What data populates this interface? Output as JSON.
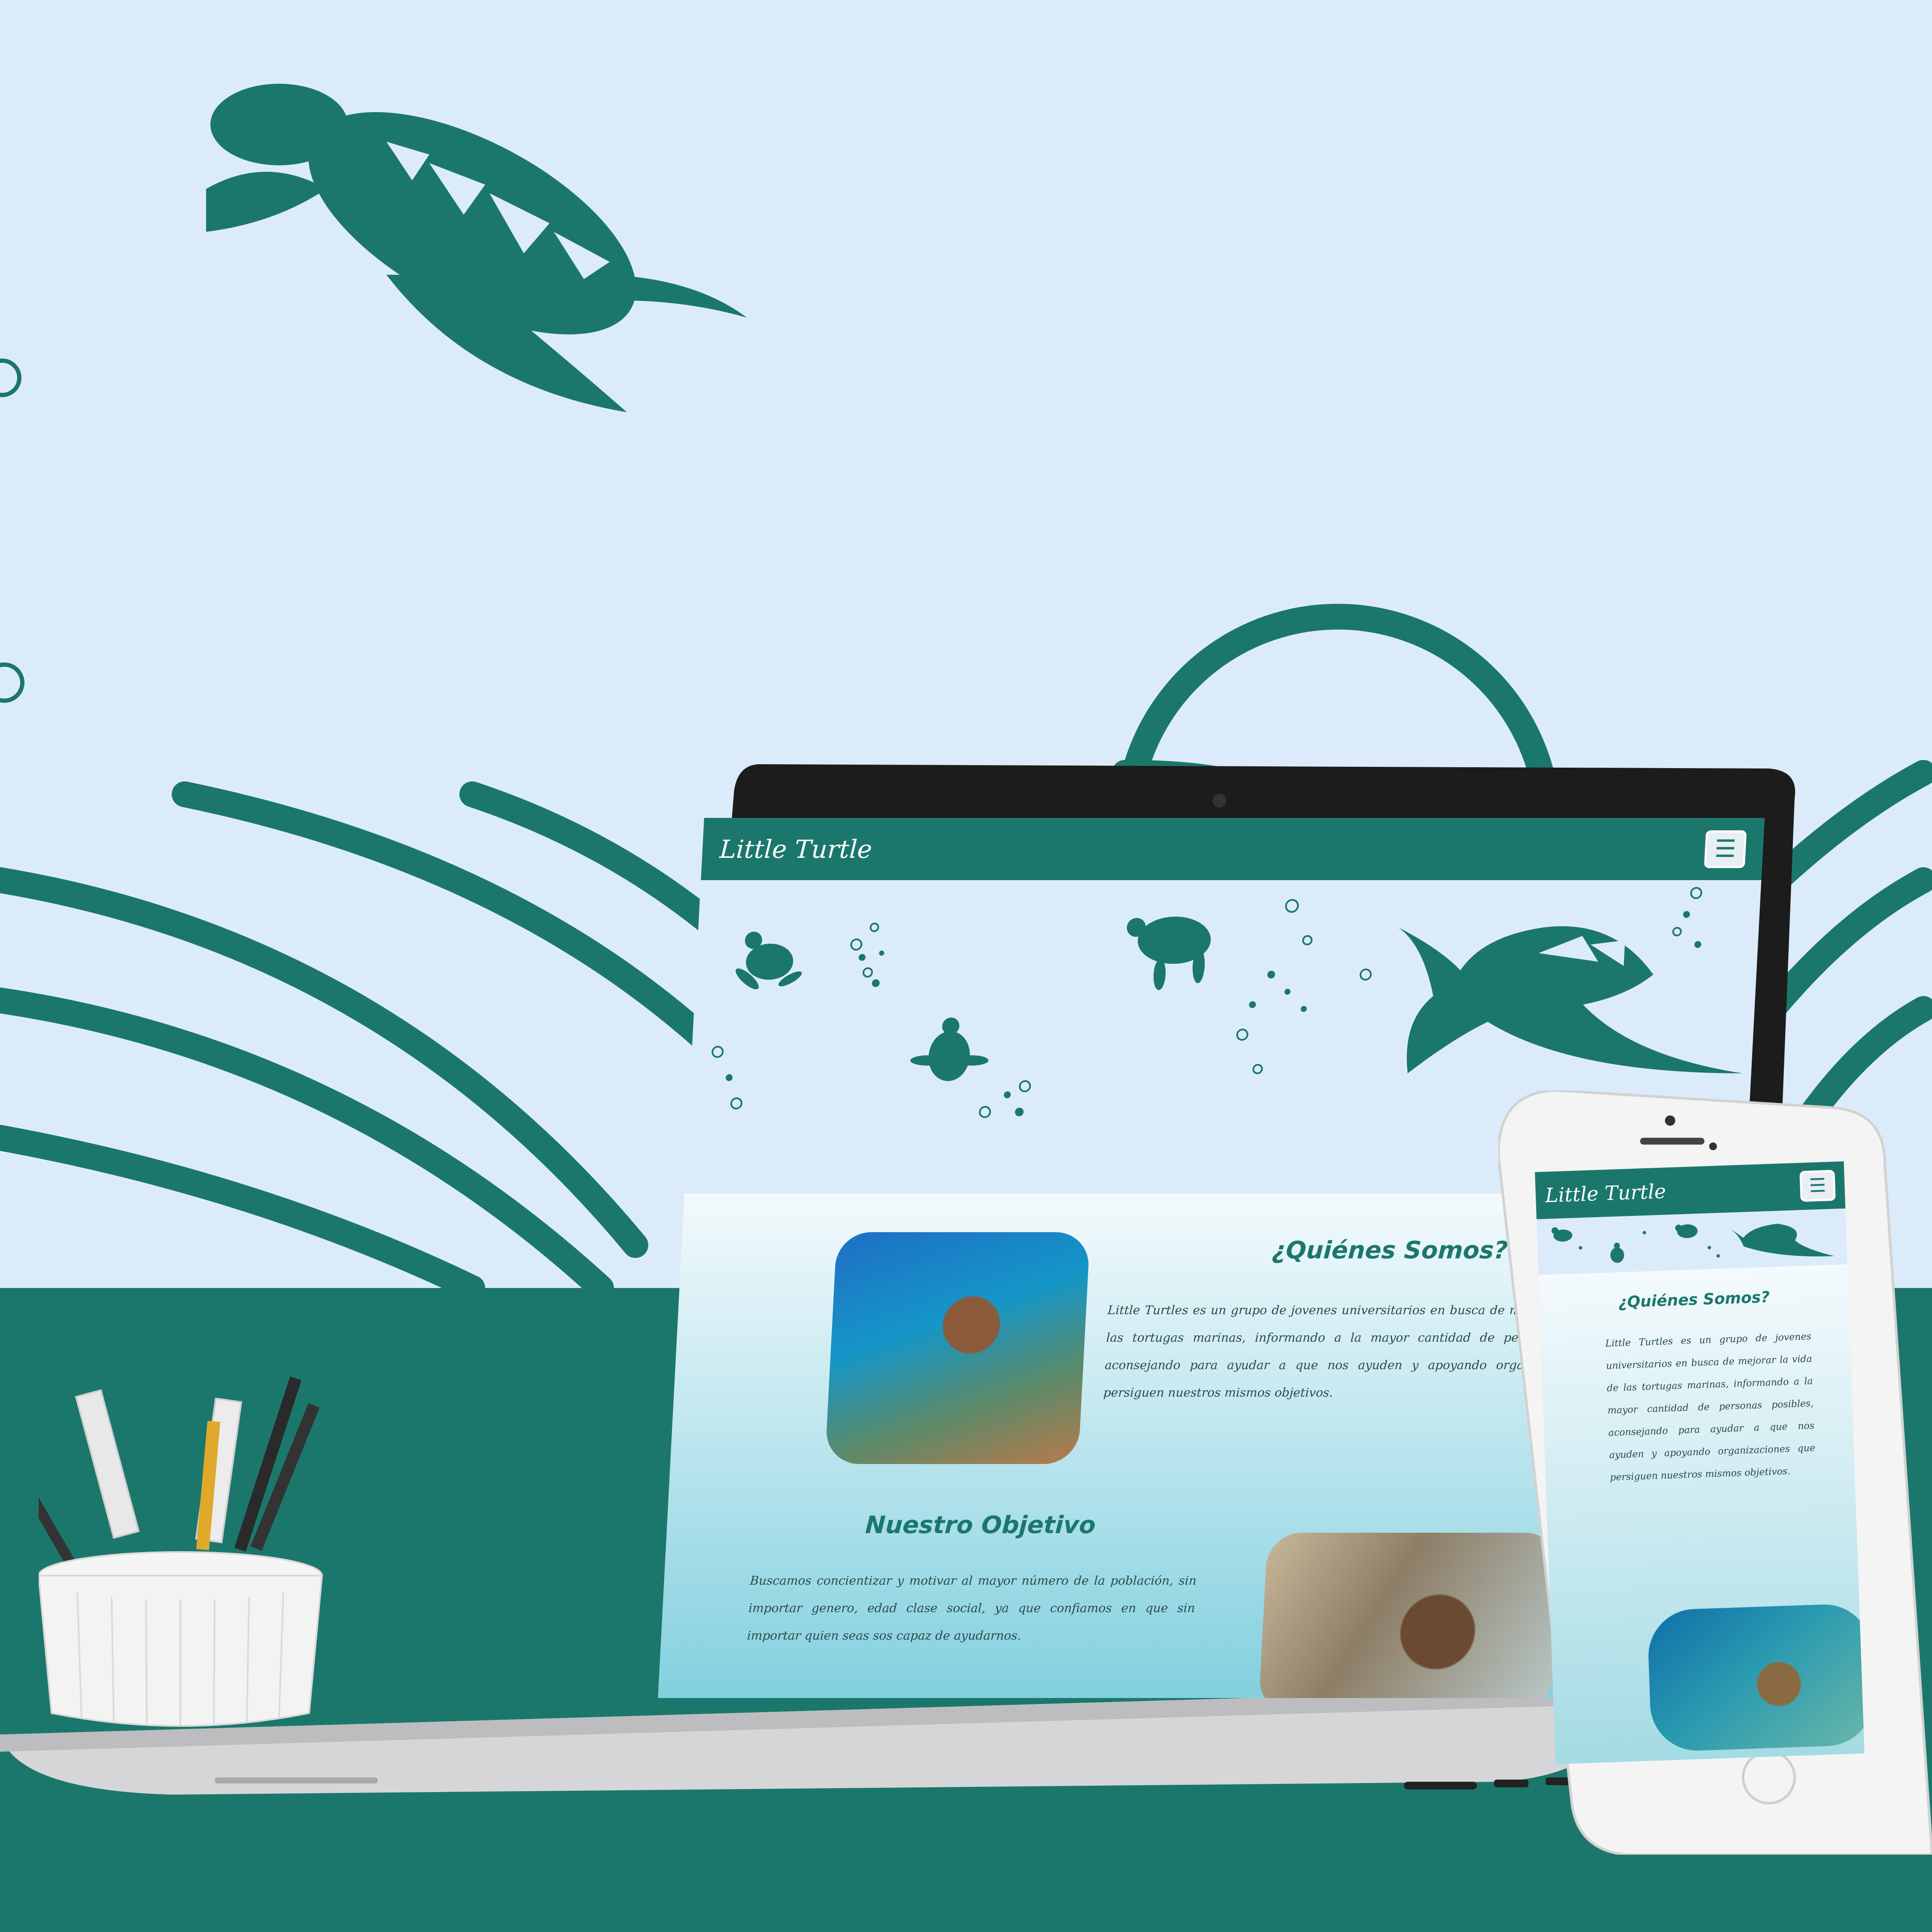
{
  "colors": {
    "brand_teal": "#1b776c",
    "background": "#dcebfa",
    "gradient_bottom": "#82d0de",
    "white": "#ffffff"
  },
  "laptop_site": {
    "brand": "Little Turtle",
    "menu_icon": "hamburger-icon",
    "about": {
      "title": "¿Quiénes Somos?",
      "text": "Little Turtles es un grupo de jovenes universitarios en busca de mejorar la vida de las tortugas marinas, informando a la mayor cantidad de personas posibles, aconsejando para ayudar a que nos ayuden y apoyando organizaciones que persiguen nuestros mismos objetivos."
    },
    "objective": {
      "title": "Nuestro Objetivo",
      "text": "Buscamos concientizar y motivar al mayor número de la población, sin importar genero, edad clase social, ya que confiamos en que sin importar quien seas sos capaz de ayudarnos."
    }
  },
  "phone_site": {
    "brand": "Little Turtle",
    "menu_icon": "hamburger-icon",
    "about": {
      "title": "¿Quiénes Somos?",
      "text": "Little Turtles es un grupo de jovenes universitarios en busca de mejorar la vida de las tortugas marinas, informando a la mayor cantidad de personas posibles, aconsejando para ayudar a que nos ayuden y apoyando organizaciones que persiguen nuestros mismos objetivos."
    }
  }
}
